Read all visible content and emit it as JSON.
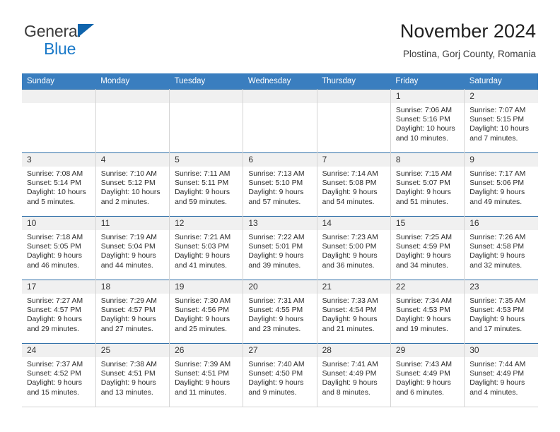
{
  "brand": {
    "name_part1": "General",
    "name_part2": "Blue",
    "accent_color": "#1878c8",
    "triangle_color": "#1064ac"
  },
  "header": {
    "title": "November 2024",
    "subtitle": "Plostina, Gorj County, Romania"
  },
  "calendar": {
    "header_bg": "#3a7ebf",
    "weekday_headers": [
      "Sunday",
      "Monday",
      "Tuesday",
      "Wednesday",
      "Thursday",
      "Friday",
      "Saturday"
    ],
    "weeks": [
      [
        {
          "day": "",
          "lines": []
        },
        {
          "day": "",
          "lines": []
        },
        {
          "day": "",
          "lines": []
        },
        {
          "day": "",
          "lines": []
        },
        {
          "day": "",
          "lines": []
        },
        {
          "day": "1",
          "lines": [
            "Sunrise: 7:06 AM",
            "Sunset: 5:16 PM",
            "Daylight: 10 hours and 10 minutes."
          ]
        },
        {
          "day": "2",
          "lines": [
            "Sunrise: 7:07 AM",
            "Sunset: 5:15 PM",
            "Daylight: 10 hours and 7 minutes."
          ]
        }
      ],
      [
        {
          "day": "3",
          "lines": [
            "Sunrise: 7:08 AM",
            "Sunset: 5:14 PM",
            "Daylight: 10 hours and 5 minutes."
          ]
        },
        {
          "day": "4",
          "lines": [
            "Sunrise: 7:10 AM",
            "Sunset: 5:12 PM",
            "Daylight: 10 hours and 2 minutes."
          ]
        },
        {
          "day": "5",
          "lines": [
            "Sunrise: 7:11 AM",
            "Sunset: 5:11 PM",
            "Daylight: 9 hours and 59 minutes."
          ]
        },
        {
          "day": "6",
          "lines": [
            "Sunrise: 7:13 AM",
            "Sunset: 5:10 PM",
            "Daylight: 9 hours and 57 minutes."
          ]
        },
        {
          "day": "7",
          "lines": [
            "Sunrise: 7:14 AM",
            "Sunset: 5:08 PM",
            "Daylight: 9 hours and 54 minutes."
          ]
        },
        {
          "day": "8",
          "lines": [
            "Sunrise: 7:15 AM",
            "Sunset: 5:07 PM",
            "Daylight: 9 hours and 51 minutes."
          ]
        },
        {
          "day": "9",
          "lines": [
            "Sunrise: 7:17 AM",
            "Sunset: 5:06 PM",
            "Daylight: 9 hours and 49 minutes."
          ]
        }
      ],
      [
        {
          "day": "10",
          "lines": [
            "Sunrise: 7:18 AM",
            "Sunset: 5:05 PM",
            "Daylight: 9 hours and 46 minutes."
          ]
        },
        {
          "day": "11",
          "lines": [
            "Sunrise: 7:19 AM",
            "Sunset: 5:04 PM",
            "Daylight: 9 hours and 44 minutes."
          ]
        },
        {
          "day": "12",
          "lines": [
            "Sunrise: 7:21 AM",
            "Sunset: 5:03 PM",
            "Daylight: 9 hours and 41 minutes."
          ]
        },
        {
          "day": "13",
          "lines": [
            "Sunrise: 7:22 AM",
            "Sunset: 5:01 PM",
            "Daylight: 9 hours and 39 minutes."
          ]
        },
        {
          "day": "14",
          "lines": [
            "Sunrise: 7:23 AM",
            "Sunset: 5:00 PM",
            "Daylight: 9 hours and 36 minutes."
          ]
        },
        {
          "day": "15",
          "lines": [
            "Sunrise: 7:25 AM",
            "Sunset: 4:59 PM",
            "Daylight: 9 hours and 34 minutes."
          ]
        },
        {
          "day": "16",
          "lines": [
            "Sunrise: 7:26 AM",
            "Sunset: 4:58 PM",
            "Daylight: 9 hours and 32 minutes."
          ]
        }
      ],
      [
        {
          "day": "17",
          "lines": [
            "Sunrise: 7:27 AM",
            "Sunset: 4:57 PM",
            "Daylight: 9 hours and 29 minutes."
          ]
        },
        {
          "day": "18",
          "lines": [
            "Sunrise: 7:29 AM",
            "Sunset: 4:57 PM",
            "Daylight: 9 hours and 27 minutes."
          ]
        },
        {
          "day": "19",
          "lines": [
            "Sunrise: 7:30 AM",
            "Sunset: 4:56 PM",
            "Daylight: 9 hours and 25 minutes."
          ]
        },
        {
          "day": "20",
          "lines": [
            "Sunrise: 7:31 AM",
            "Sunset: 4:55 PM",
            "Daylight: 9 hours and 23 minutes."
          ]
        },
        {
          "day": "21",
          "lines": [
            "Sunrise: 7:33 AM",
            "Sunset: 4:54 PM",
            "Daylight: 9 hours and 21 minutes."
          ]
        },
        {
          "day": "22",
          "lines": [
            "Sunrise: 7:34 AM",
            "Sunset: 4:53 PM",
            "Daylight: 9 hours and 19 minutes."
          ]
        },
        {
          "day": "23",
          "lines": [
            "Sunrise: 7:35 AM",
            "Sunset: 4:53 PM",
            "Daylight: 9 hours and 17 minutes."
          ]
        }
      ],
      [
        {
          "day": "24",
          "lines": [
            "Sunrise: 7:37 AM",
            "Sunset: 4:52 PM",
            "Daylight: 9 hours and 15 minutes."
          ]
        },
        {
          "day": "25",
          "lines": [
            "Sunrise: 7:38 AM",
            "Sunset: 4:51 PM",
            "Daylight: 9 hours and 13 minutes."
          ]
        },
        {
          "day": "26",
          "lines": [
            "Sunrise: 7:39 AM",
            "Sunset: 4:51 PM",
            "Daylight: 9 hours and 11 minutes."
          ]
        },
        {
          "day": "27",
          "lines": [
            "Sunrise: 7:40 AM",
            "Sunset: 4:50 PM",
            "Daylight: 9 hours and 9 minutes."
          ]
        },
        {
          "day": "28",
          "lines": [
            "Sunrise: 7:41 AM",
            "Sunset: 4:49 PM",
            "Daylight: 9 hours and 8 minutes."
          ]
        },
        {
          "day": "29",
          "lines": [
            "Sunrise: 7:43 AM",
            "Sunset: 4:49 PM",
            "Daylight: 9 hours and 6 minutes."
          ]
        },
        {
          "day": "30",
          "lines": [
            "Sunrise: 7:44 AM",
            "Sunset: 4:49 PM",
            "Daylight: 9 hours and 4 minutes."
          ]
        }
      ]
    ]
  }
}
